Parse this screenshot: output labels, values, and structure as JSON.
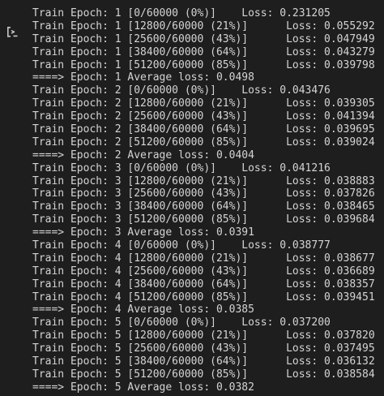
{
  "output": {
    "icon": "output-toggle-icon",
    "lines": [
      "Train Epoch: 1 [0/60000 (0%)]    Loss: 0.231205",
      "Train Epoch: 1 [12800/60000 (21%)]      Loss: 0.055292",
      "Train Epoch: 1 [25600/60000 (43%)]      Loss: 0.047949",
      "Train Epoch: 1 [38400/60000 (64%)]      Loss: 0.043279",
      "Train Epoch: 1 [51200/60000 (85%)]      Loss: 0.039798",
      "====> Epoch: 1 Average loss: 0.0498",
      "Train Epoch: 2 [0/60000 (0%)]    Loss: 0.043476",
      "Train Epoch: 2 [12800/60000 (21%)]      Loss: 0.039305",
      "Train Epoch: 2 [25600/60000 (43%)]      Loss: 0.041394",
      "Train Epoch: 2 [38400/60000 (64%)]      Loss: 0.039695",
      "Train Epoch: 2 [51200/60000 (85%)]      Loss: 0.039024",
      "====> Epoch: 2 Average loss: 0.0404",
      "Train Epoch: 3 [0/60000 (0%)]    Loss: 0.041216",
      "Train Epoch: 3 [12800/60000 (21%)]      Loss: 0.038883",
      "Train Epoch: 3 [25600/60000 (43%)]      Loss: 0.037826",
      "Train Epoch: 3 [38400/60000 (64%)]      Loss: 0.038465",
      "Train Epoch: 3 [51200/60000 (85%)]      Loss: 0.039684",
      "====> Epoch: 3 Average loss: 0.0391",
      "Train Epoch: 4 [0/60000 (0%)]    Loss: 0.038777",
      "Train Epoch: 4 [12800/60000 (21%)]      Loss: 0.038677",
      "Train Epoch: 4 [25600/60000 (43%)]      Loss: 0.036689",
      "Train Epoch: 4 [38400/60000 (64%)]      Loss: 0.038357",
      "Train Epoch: 4 [51200/60000 (85%)]      Loss: 0.039451",
      "====> Epoch: 4 Average loss: 0.0385",
      "Train Epoch: 5 [0/60000 (0%)]    Loss: 0.037200",
      "Train Epoch: 5 [12800/60000 (21%)]      Loss: 0.037820",
      "Train Epoch: 5 [25600/60000 (43%)]      Loss: 0.037495",
      "Train Epoch: 5 [38400/60000 (64%)]      Loss: 0.036132",
      "Train Epoch: 5 [51200/60000 (85%)]      Loss: 0.038584",
      "====> Epoch: 5 Average loss: 0.0382"
    ]
  },
  "colors": {
    "background": "#1e1e1e",
    "text": "#d4d4d4",
    "icon": "#c8c8c8"
  }
}
